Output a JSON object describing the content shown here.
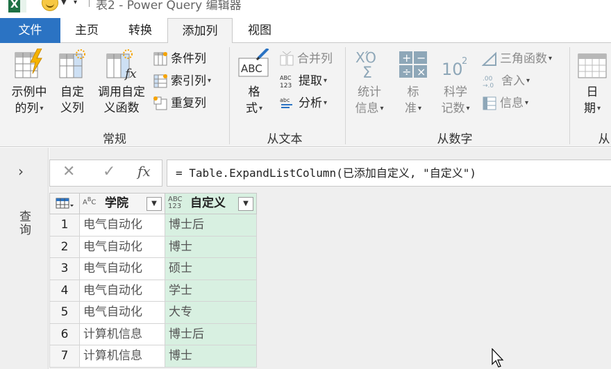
{
  "titlebar": {
    "title": "表2 - Power Query 编辑器"
  },
  "tabs": [
    {
      "label": "文件"
    },
    {
      "label": "主页"
    },
    {
      "label": "转换"
    },
    {
      "label": "添加列"
    },
    {
      "label": "视图"
    }
  ],
  "ribbon": {
    "general": {
      "group_label": "常规",
      "example_column": {
        "line1": "示例中",
        "line2": "的列"
      },
      "custom_column": {
        "line1": "自定",
        "line2": "义列"
      },
      "invoke_function": {
        "line1": "调用自定",
        "line2": "义函数"
      },
      "conditional_column": "条件列",
      "index_column": "索引列",
      "duplicate_column": "重复列"
    },
    "from_text": {
      "group_label": "从文本",
      "format": {
        "line1": "格",
        "line2": "式"
      },
      "merge_columns": "合并列",
      "extract": "提取",
      "parse": "分析"
    },
    "from_number": {
      "group_label": "从数字",
      "statistics": {
        "line1": "统计",
        "line2": "信息"
      },
      "standard": {
        "line1": "标",
        "line2": "准"
      },
      "scientific": {
        "line1": "科学",
        "line2": "记数"
      },
      "trigonometry": "三角函数",
      "rounding": "舍入",
      "information": "信息"
    },
    "from_date": {
      "group_label": "从",
      "date": {
        "line1": "日",
        "line2": "期"
      }
    }
  },
  "query_pane": {
    "label": "查询"
  },
  "formula_bar": {
    "fx": "fx",
    "formula": "= Table.ExpandListColumn(已添加自定义, \"自定义\")"
  },
  "table": {
    "columns": [
      {
        "type": "ABC",
        "name": "学院"
      },
      {
        "type": "ABC 123",
        "name": "自定义"
      }
    ],
    "rows": [
      {
        "num": "1",
        "c1": "电气自动化",
        "c2": "博士后"
      },
      {
        "num": "2",
        "c1": "电气自动化",
        "c2": "博士"
      },
      {
        "num": "3",
        "c1": "电气自动化",
        "c2": "硕士"
      },
      {
        "num": "4",
        "c1": "电气自动化",
        "c2": "学士"
      },
      {
        "num": "5",
        "c1": "电气自动化",
        "c2": "大专"
      },
      {
        "num": "6",
        "c1": "计算机信息",
        "c2": "博士后"
      },
      {
        "num": "7",
        "c1": "计算机信息",
        "c2": "博士"
      }
    ]
  },
  "colors": {
    "file_tab": "#2b73c3",
    "selected_column": "#d8f0e1",
    "ribbon_bg": "#f3f3f3"
  }
}
